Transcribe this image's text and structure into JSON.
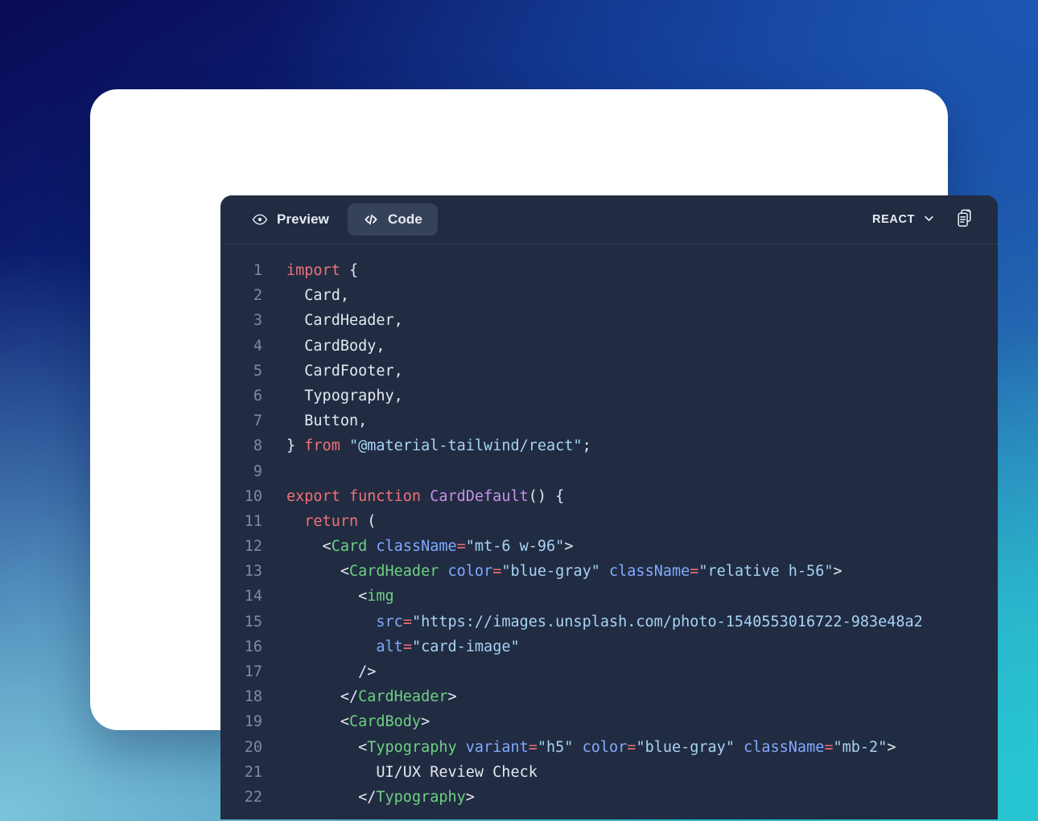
{
  "background": {
    "gradient_from": "#0a0a55",
    "gradient_mid": "#1d57b4",
    "gradient_to": "#2cbfd0"
  },
  "editor": {
    "panel_bg": "#212c42",
    "frame_bg": "#ffffff",
    "toolbar": {
      "tabs": [
        {
          "label": "Preview",
          "icon": "eye-icon",
          "active": false
        },
        {
          "label": "Code",
          "icon": "code-brackets-icon",
          "active": true
        }
      ],
      "language": {
        "label": "REACT",
        "chevron_icon": "chevron-down-icon"
      },
      "copy": {
        "icon": "clipboard-copy-icon",
        "title": "Copy"
      }
    },
    "code": {
      "language": "jsx",
      "first_line_number": 1,
      "lines": [
        {
          "n": 1,
          "tokens": [
            {
              "t": "kw",
              "v": "import"
            },
            {
              "t": "plain",
              "v": " {"
            }
          ]
        },
        {
          "n": 2,
          "tokens": [
            {
              "t": "plain",
              "v": "  Card,"
            }
          ]
        },
        {
          "n": 3,
          "tokens": [
            {
              "t": "plain",
              "v": "  CardHeader,"
            }
          ]
        },
        {
          "n": 4,
          "tokens": [
            {
              "t": "plain",
              "v": "  CardBody,"
            }
          ]
        },
        {
          "n": 5,
          "tokens": [
            {
              "t": "plain",
              "v": "  CardFooter,"
            }
          ]
        },
        {
          "n": 6,
          "tokens": [
            {
              "t": "plain",
              "v": "  Typography,"
            }
          ]
        },
        {
          "n": 7,
          "tokens": [
            {
              "t": "plain",
              "v": "  Button,"
            }
          ]
        },
        {
          "n": 8,
          "tokens": [
            {
              "t": "plain",
              "v": "} "
            },
            {
              "t": "kw",
              "v": "from"
            },
            {
              "t": "plain",
              "v": " "
            },
            {
              "t": "sstr",
              "v": "\"@material-tailwind/react\""
            },
            {
              "t": "plain",
              "v": ";"
            }
          ]
        },
        {
          "n": 9,
          "tokens": [
            {
              "t": "plain",
              "v": ""
            }
          ]
        },
        {
          "n": 10,
          "tokens": [
            {
              "t": "kw",
              "v": "export function "
            },
            {
              "t": "fn",
              "v": "CardDefault"
            },
            {
              "t": "plain",
              "v": "() {"
            }
          ]
        },
        {
          "n": 11,
          "tokens": [
            {
              "t": "plain",
              "v": "  "
            },
            {
              "t": "kw",
              "v": "return"
            },
            {
              "t": "plain",
              "v": " ("
            }
          ]
        },
        {
          "n": 12,
          "tokens": [
            {
              "t": "plain",
              "v": "    <"
            },
            {
              "t": "tag",
              "v": "Card"
            },
            {
              "t": "plain",
              "v": " "
            },
            {
              "t": "attr",
              "v": "className"
            },
            {
              "t": "op",
              "v": "="
            },
            {
              "t": "sstr",
              "v": "\"mt-6 w-96\""
            },
            {
              "t": "plain",
              "v": ">"
            }
          ]
        },
        {
          "n": 13,
          "tokens": [
            {
              "t": "plain",
              "v": "      <"
            },
            {
              "t": "tag",
              "v": "CardHeader"
            },
            {
              "t": "plain",
              "v": " "
            },
            {
              "t": "attr",
              "v": "color"
            },
            {
              "t": "op",
              "v": "="
            },
            {
              "t": "sstr",
              "v": "\"blue-gray\""
            },
            {
              "t": "plain",
              "v": " "
            },
            {
              "t": "attr",
              "v": "className"
            },
            {
              "t": "op",
              "v": "="
            },
            {
              "t": "sstr",
              "v": "\"relative h-56\""
            },
            {
              "t": "plain",
              "v": ">"
            }
          ]
        },
        {
          "n": 14,
          "tokens": [
            {
              "t": "plain",
              "v": "        <"
            },
            {
              "t": "tag",
              "v": "img"
            }
          ]
        },
        {
          "n": 15,
          "tokens": [
            {
              "t": "plain",
              "v": "          "
            },
            {
              "t": "attr",
              "v": "src"
            },
            {
              "t": "op",
              "v": "="
            },
            {
              "t": "sstr",
              "v": "\"https://images.unsplash.com/photo-1540553016722-983e48a2"
            }
          ]
        },
        {
          "n": 16,
          "tokens": [
            {
              "t": "plain",
              "v": "          "
            },
            {
              "t": "attr",
              "v": "alt"
            },
            {
              "t": "op",
              "v": "="
            },
            {
              "t": "sstr",
              "v": "\"card-image\""
            }
          ]
        },
        {
          "n": 17,
          "tokens": [
            {
              "t": "plain",
              "v": "        />"
            }
          ]
        },
        {
          "n": 18,
          "tokens": [
            {
              "t": "plain",
              "v": "      </"
            },
            {
              "t": "tag",
              "v": "CardHeader"
            },
            {
              "t": "plain",
              "v": ">"
            }
          ]
        },
        {
          "n": 19,
          "tokens": [
            {
              "t": "plain",
              "v": "      <"
            },
            {
              "t": "tag",
              "v": "CardBody"
            },
            {
              "t": "plain",
              "v": ">"
            }
          ]
        },
        {
          "n": 20,
          "tokens": [
            {
              "t": "plain",
              "v": "        <"
            },
            {
              "t": "tag",
              "v": "Typography"
            },
            {
              "t": "plain",
              "v": " "
            },
            {
              "t": "attr",
              "v": "variant"
            },
            {
              "t": "op",
              "v": "="
            },
            {
              "t": "sstr",
              "v": "\"h5\""
            },
            {
              "t": "plain",
              "v": " "
            },
            {
              "t": "attr",
              "v": "color"
            },
            {
              "t": "op",
              "v": "="
            },
            {
              "t": "sstr",
              "v": "\"blue-gray\""
            },
            {
              "t": "plain",
              "v": " "
            },
            {
              "t": "attr",
              "v": "className"
            },
            {
              "t": "op",
              "v": "="
            },
            {
              "t": "sstr",
              "v": "\"mb-2\""
            },
            {
              "t": "plain",
              "v": ">"
            }
          ]
        },
        {
          "n": 21,
          "tokens": [
            {
              "t": "plain",
              "v": "          UI/UX Review Check"
            }
          ]
        },
        {
          "n": 22,
          "tokens": [
            {
              "t": "plain",
              "v": "        </"
            },
            {
              "t": "tag",
              "v": "Typography"
            },
            {
              "t": "plain",
              "v": ">"
            }
          ]
        }
      ]
    }
  }
}
